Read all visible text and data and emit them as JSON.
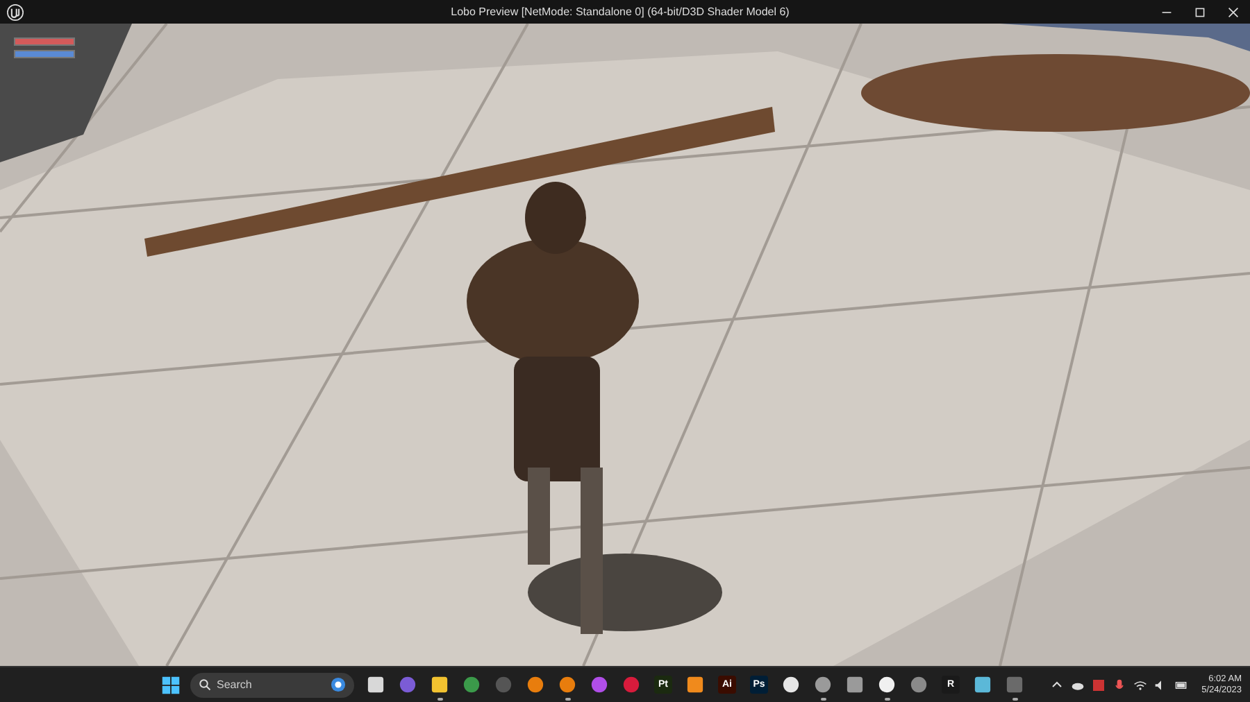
{
  "window": {
    "title": "Lobo Preview [NetMode: Standalone 0]  (64-bit/D3D Shader Model 6)"
  },
  "hud": {
    "health": {
      "level": 1
    },
    "stamina": {
      "level": 1
    }
  },
  "taskbar": {
    "search": {
      "placeholder": "Search"
    },
    "apps": [
      {
        "kind": "square",
        "color": "#d8d8d8",
        "running": false
      },
      {
        "kind": "circle",
        "color": "#7b5cd6",
        "running": false
      },
      {
        "kind": "square",
        "color": "#f2c230",
        "running": true
      },
      {
        "kind": "circle",
        "color": "#3b9a4a",
        "running": false
      },
      {
        "kind": "circle",
        "color": "#555555",
        "running": false
      },
      {
        "kind": "circle",
        "color": "#e87d0d",
        "running": false
      },
      {
        "kind": "circle",
        "color": "#e87d0d",
        "running": true
      },
      {
        "kind": "circle",
        "color": "#b04ee8",
        "running": false
      },
      {
        "kind": "circle",
        "color": "#d81b3c",
        "running": false
      },
      {
        "kind": "text",
        "label": "Pt",
        "color": "#1b2a10",
        "running": false
      },
      {
        "kind": "square",
        "color": "#f08a1c",
        "running": false
      },
      {
        "kind": "text",
        "label": "Ai",
        "color": "#3a0c00",
        "running": false
      },
      {
        "kind": "text",
        "label": "Ps",
        "color": "#001e36",
        "running": false
      },
      {
        "kind": "circle",
        "color": "#e6e6e6",
        "running": false
      },
      {
        "kind": "circle",
        "color": "#9a9a9a",
        "running": true
      },
      {
        "kind": "square",
        "color": "#9a9a9a",
        "running": false
      },
      {
        "kind": "circle",
        "color": "#f0f0f0",
        "running": true
      },
      {
        "kind": "circle",
        "color": "#8a8a8a",
        "running": false
      },
      {
        "kind": "text",
        "label": "R",
        "color": "#1a1a1a",
        "running": false
      },
      {
        "kind": "square",
        "color": "#5bb8d8",
        "running": false
      },
      {
        "kind": "square",
        "color": "#6a6a6a",
        "running": true
      }
    ],
    "clock": {
      "time": "6:02 AM",
      "date": "5/24/2023"
    }
  }
}
